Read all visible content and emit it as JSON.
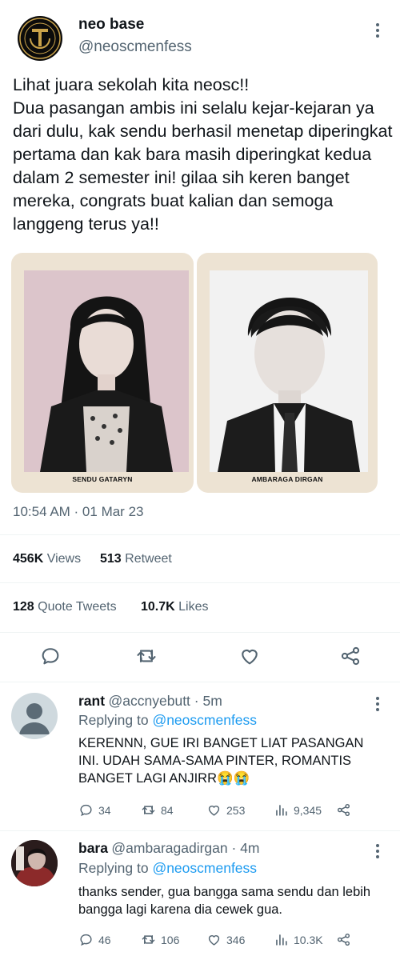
{
  "tweet": {
    "author_name": "neo base",
    "author_handle": "@neoscmenfess",
    "text": "Lihat juara sekolah kita neosc!!\nDua pasangan ambis ini selalu kejar-kejaran ya dari dulu, kak sendu berhasil menetap diperingkat pertama dan kak bara masih diperingkat kedua dalam 2 semester ini! gilaa sih keren banget mereka, congrats buat kalian dan semoga langgeng terus ya!!",
    "photos": [
      {
        "caption": "SENDU GATARYN"
      },
      {
        "caption": "AMBARAGA DIRGAN"
      }
    ],
    "timestamp": "10:54 AM · 01 Mar 23",
    "stats": {
      "views_count": "456K",
      "views_label": "Views",
      "retweets_count": "513",
      "retweets_label": "Retweet",
      "quotes_count": "128",
      "quotes_label": "Quote Tweets",
      "likes_count": "10.7K",
      "likes_label": "Likes"
    }
  },
  "replies": [
    {
      "name": "rant",
      "handle": "@accnyebutt · 5m",
      "replying_prefix": "Replying to",
      "replying_to": "@neoscmenfess",
      "text": "KERENNN, GUE IRI BANGET LIAT PASANGAN INI. UDAH SAMA-SAMA PINTER, ROMANTIS BANGET LAGI ANJIRR😭😭",
      "reply_count": "34",
      "retweet_count": "84",
      "like_count": "253",
      "view_count": "9,345"
    },
    {
      "name": "bara",
      "handle": "@ambaragadirgan · 4m",
      "replying_prefix": "Replying to",
      "replying_to": "@neoscmenfess",
      "text": "thanks sender, gua bangga sama sendu dan lebih bangga lagi karena dia cewek gua.",
      "reply_count": "46",
      "retweet_count": "106",
      "like_count": "346",
      "view_count": "10.3K"
    }
  ],
  "icons": {
    "reply": "reply-icon",
    "retweet": "retweet-icon",
    "like": "like-icon",
    "share": "share-icon",
    "views": "views-icon",
    "more": "more-icon"
  },
  "colors": {
    "link": "#1d9bf0",
    "secondary_text": "#536471"
  }
}
